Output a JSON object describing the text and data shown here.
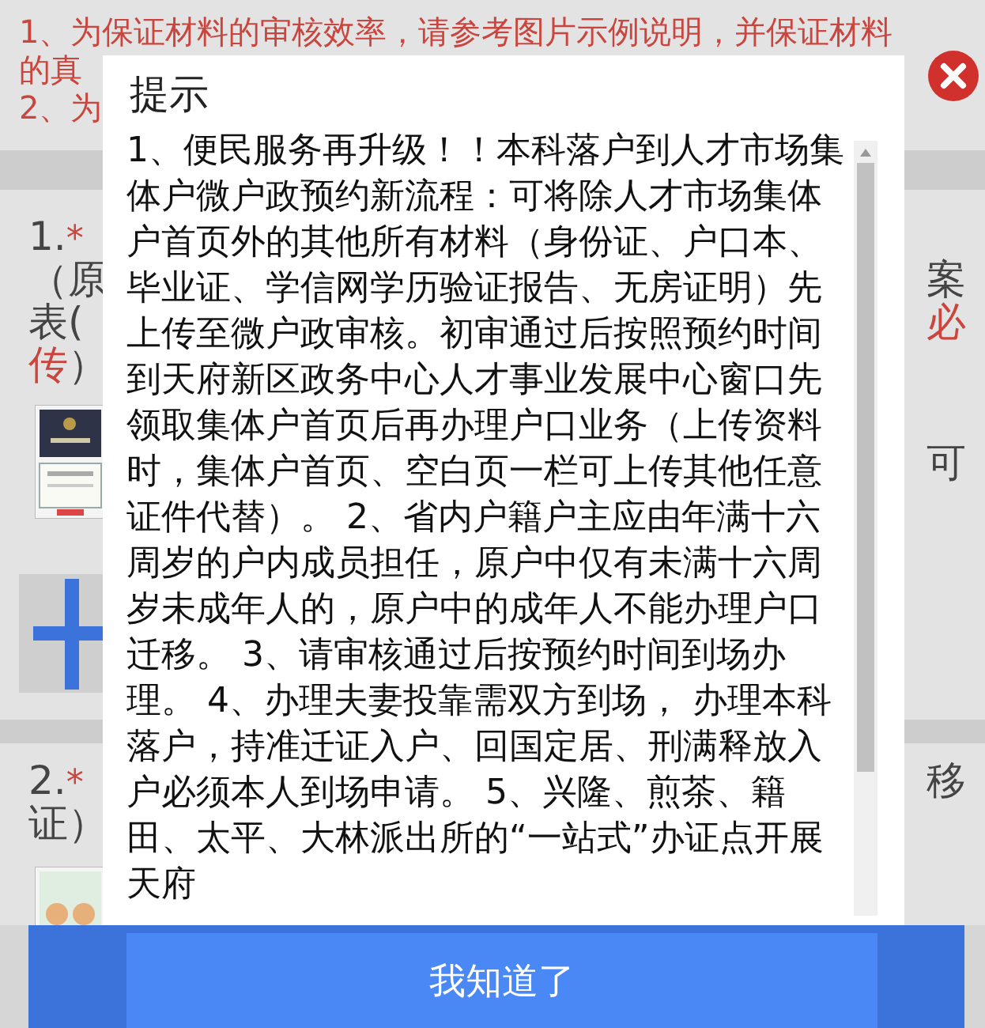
{
  "notice": {
    "lines": [
      "1、为保证材料的审核效率，请参考图片示例说明，并保证材料",
      "的真",
      "2、为"
    ]
  },
  "sections": [
    {
      "items": [
        {
          "kind": "text_row",
          "left": [
            {
              "text": "1.",
              "kind": "plain"
            },
            {
              "text": "*",
              "kind": "mark"
            }
          ]
        },
        {
          "kind": "text_row",
          "left": [
            {
              "text": "（原",
              "kind": "plain"
            }
          ],
          "right": [
            {
              "text": "案",
              "kind": "plain"
            }
          ]
        },
        {
          "kind": "text_row",
          "left": [
            {
              "text": "表(",
              "kind": "plain"
            }
          ],
          "right": [
            {
              "text": "必",
              "kind": "required"
            }
          ]
        },
        {
          "kind": "text_row",
          "left": [
            {
              "text": "传",
              "kind": "required"
            },
            {
              "text": "）",
              "kind": "plain"
            }
          ]
        },
        {
          "kind": "thumbs",
          "pictures": [
            {
              "kind": "picture"
            }
          ],
          "right": [
            {
              "text": "可",
              "kind": "plain"
            }
          ]
        },
        {
          "kind": "upload"
        }
      ]
    },
    {
      "items": [
        {
          "kind": "text_row",
          "left": [
            {
              "text": "2.",
              "kind": "plain"
            },
            {
              "text": "*",
              "kind": "mark"
            }
          ],
          "right": [
            {
              "text": "移",
              "kind": "plain"
            }
          ]
        },
        {
          "kind": "text_row",
          "left": [
            {
              "text": "证）",
              "kind": "plain"
            }
          ]
        },
        {
          "kind": "thumbs",
          "pictures": [
            {
              "kind": "picture"
            }
          ]
        }
      ]
    }
  ],
  "dialog": {
    "title": "提示",
    "text": "1、便民服务再升级！！本科落户到人才市场集体户微户政预约新流程：可将除人才市场集体户首页外的其他所有材料（身份证、户口本、毕业证、学信网学历验证报告、无房证明）先上传至微户政审核。初审通过后按照预约时间到天府新区政务中心人才事业发展中心窗口先领取集体户首页后再办理户口业务（上传资料时，集体户首页、空白页一栏可上传其他任意证件代替）。 2、省内户籍户主应由年满十六周岁的户内成员担任，原户中仅有未满十六周岁未成年人的，原户中的成年人不能办理户口迁移。 3、请审核通过后按预约时间到场办理。 4、办理夫妻投靠需双方到场， 办理本科落户，持准迁证入户、回国定居、刑满释放入户必须本人到场申请。 5、兴隆、煎茶、籍田、太平、大林派出所的“一站式”办证点开展天府",
    "button": "我知道了"
  }
}
